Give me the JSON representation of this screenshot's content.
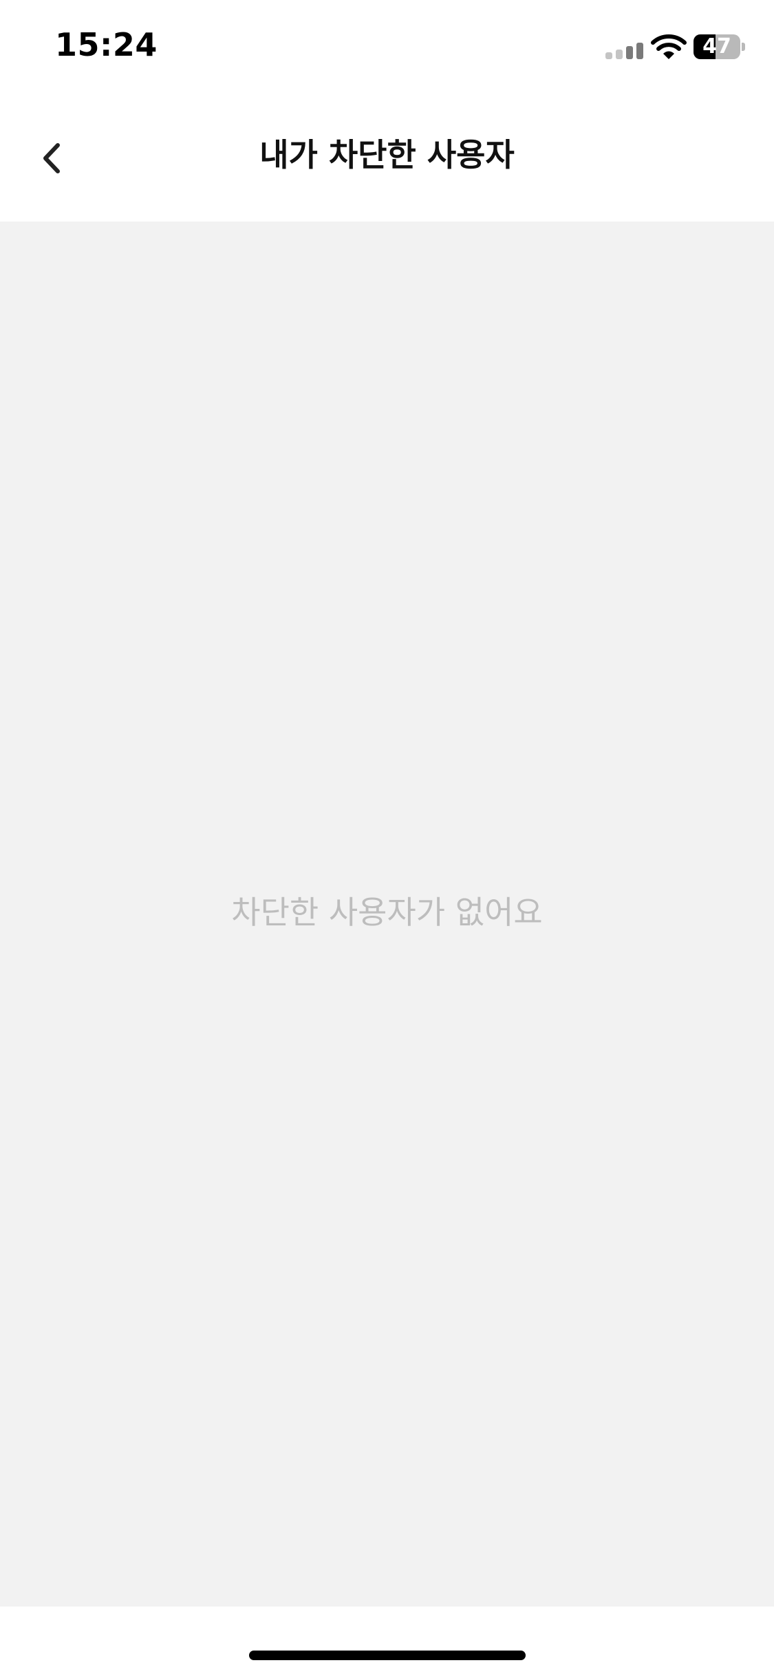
{
  "status_bar": {
    "time": "15:24",
    "battery_level": "47",
    "battery_fraction": 0.47,
    "icons": [
      "signal-icon",
      "wifi-icon",
      "battery-icon"
    ]
  },
  "header": {
    "title": "내가 차단한 사용자",
    "back_icon": "chevron-left-icon"
  },
  "main": {
    "empty_message": "차단한 사용자가 없어요"
  },
  "colors": {
    "background": "#ffffff",
    "content_background": "#f2f2f2",
    "title_text": "#111111",
    "empty_text": "#bdbdbd"
  }
}
